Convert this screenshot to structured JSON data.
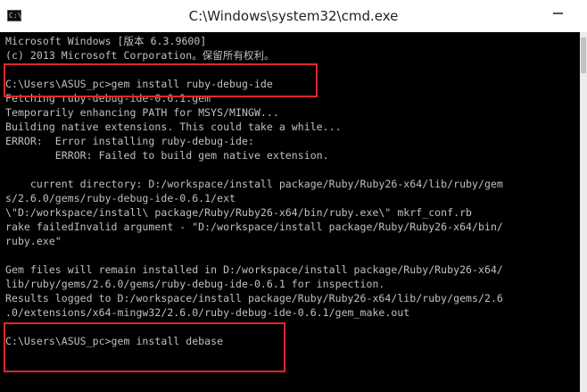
{
  "window": {
    "title": "C:\\Windows\\system32\\cmd.exe",
    "icon": "cmd-icon"
  },
  "console": {
    "lines": [
      "Microsoft Windows [版本 6.3.9600]",
      "(c) 2013 Microsoft Corporation。保留所有权利。",
      "",
      "C:\\Users\\ASUS_pc>gem install ruby-debug-ide",
      "Fetching ruby-debug-ide-0.6.1.gem",
      "Temporarily enhancing PATH for MSYS/MINGW...",
      "Building native extensions. This could take a while...",
      "ERROR:  Error installing ruby-debug-ide:",
      "        ERROR: Failed to build gem native extension.",
      "",
      "    current directory: D:/workspace/install package/Ruby/Ruby26-x64/lib/ruby/gem",
      "s/2.6.0/gems/ruby-debug-ide-0.6.1/ext",
      "\\\"D:/workspace/install\\ package/Ruby/Ruby26-x64/bin/ruby.exe\\\" mkrf_conf.rb",
      "rake failedInvalid argument - \"D:/workspace/install package/Ruby/Ruby26-x64/bin/",
      "ruby.exe\"",
      "",
      "Gem files will remain installed in D:/workspace/install package/Ruby/Ruby26-x64/",
      "lib/ruby/gems/2.6.0/gems/ruby-debug-ide-0.6.1 for inspection.",
      "Results logged to D:/workspace/install package/Ruby/Ruby26-x64/lib/ruby/gems/2.6",
      ".0/extensions/x64-mingw32/2.6.0/ruby-debug-ide-0.6.1/gem_make.out",
      "",
      "C:\\Users\\ASUS_pc>gem install debase"
    ]
  },
  "colors": {
    "console_bg": "#000000",
    "console_text": "#c0c0c0",
    "annotation": "#e02828"
  }
}
